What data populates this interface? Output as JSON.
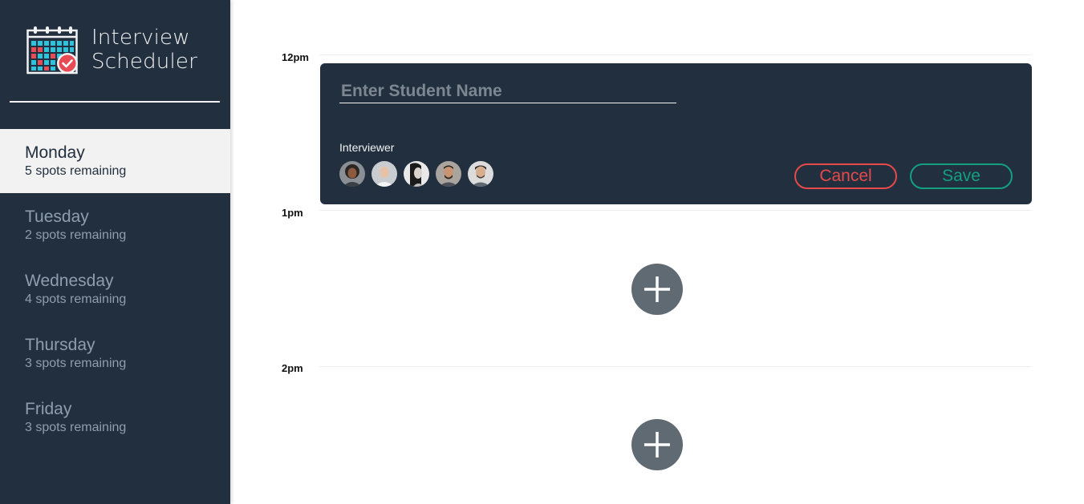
{
  "brand": {
    "title": "Interview\nScheduler",
    "icon": "calendar-check-icon"
  },
  "days": [
    {
      "name": "Monday",
      "spots": "5 spots remaining",
      "selected": true
    },
    {
      "name": "Tuesday",
      "spots": "2 spots remaining",
      "selected": false
    },
    {
      "name": "Wednesday",
      "spots": "4 spots remaining",
      "selected": false
    },
    {
      "name": "Thursday",
      "spots": "3 spots remaining",
      "selected": false
    },
    {
      "name": "Friday",
      "spots": "3 spots remaining",
      "selected": false
    }
  ],
  "schedule": {
    "hours": [
      "12pm",
      "1pm",
      "2pm"
    ]
  },
  "form": {
    "student_placeholder": "Enter Student Name",
    "student_value": "",
    "interviewer_label": "Interviewer",
    "interviewers": [
      {
        "icon": "interviewer-avatar-1"
      },
      {
        "icon": "interviewer-avatar-2"
      },
      {
        "icon": "interviewer-avatar-3"
      },
      {
        "icon": "interviewer-avatar-4"
      },
      {
        "icon": "interviewer-avatar-5"
      }
    ],
    "cancel_label": "Cancel",
    "save_label": "Save"
  },
  "add_button_icon": "plus-icon",
  "colors": {
    "sidebar_bg": "#222f3e",
    "selected_bg": "#f2f2f2",
    "cancel": "#e64a4a",
    "save": "#13a081",
    "add_button": "#606a72"
  }
}
